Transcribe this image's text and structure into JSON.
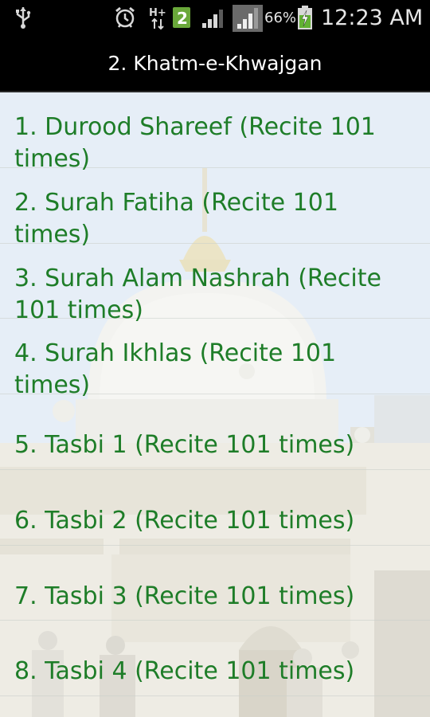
{
  "status_bar": {
    "icons": {
      "usb": "usb-icon",
      "alarm": "alarm-icon",
      "network": "h-plus-data-icon",
      "sim": "sim-2-icon",
      "signal1": "signal-strength-icon",
      "signal2": "signal-strength-icon",
      "battery": "battery-charging-icon"
    },
    "network_label": "H+",
    "sim_label": "2",
    "battery_percent": "66%",
    "time": "12:23 AM"
  },
  "title_bar": {
    "title": "2. Khatm-e-Khwajgan"
  },
  "list": {
    "items": [
      {
        "label": "1. Durood Shareef (Recite 101 times)"
      },
      {
        "label": "2. Surah Fatiha (Recite 101 times)"
      },
      {
        "label": "3. Surah Alam Nashrah (Recite 101 times)"
      },
      {
        "label": "4. Surah Ikhlas (Recite 101 times)"
      },
      {
        "label": "5. Tasbi 1 (Recite 101 times)"
      },
      {
        "label": "6. Tasbi 2 (Recite 101 times)"
      },
      {
        "label": "7. Tasbi 3 (Recite 101 times)"
      },
      {
        "label": "8. Tasbi 4 (Recite 101 times)"
      }
    ]
  },
  "colors": {
    "item_text": "#1e7d28",
    "title_text": "#ffffff",
    "bar_background": "#000000"
  }
}
